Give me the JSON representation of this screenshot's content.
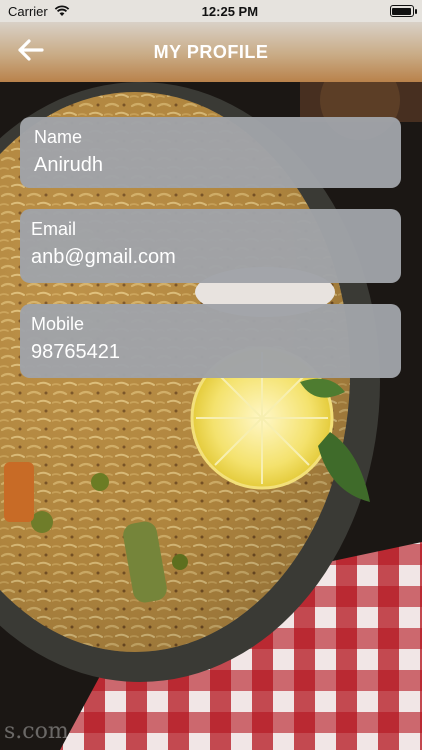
{
  "status_bar": {
    "carrier": "Carrier",
    "time": "12:25 PM",
    "icons": [
      "wifi-icon",
      "battery-icon"
    ]
  },
  "header": {
    "title": "MY PROFILE",
    "back_icon": "arrow-left-icon",
    "gradient_colors": [
      "#d9d1c7",
      "#b9824b"
    ]
  },
  "profile": {
    "fields": [
      {
        "label": "Name",
        "value": "Anirudh"
      },
      {
        "label": "Email",
        "value": "anb@gmail.com"
      },
      {
        "label": "Mobile",
        "value": "98765421"
      }
    ],
    "card_color": "#a0a3a8"
  },
  "background": {
    "watermark": "s.com"
  }
}
